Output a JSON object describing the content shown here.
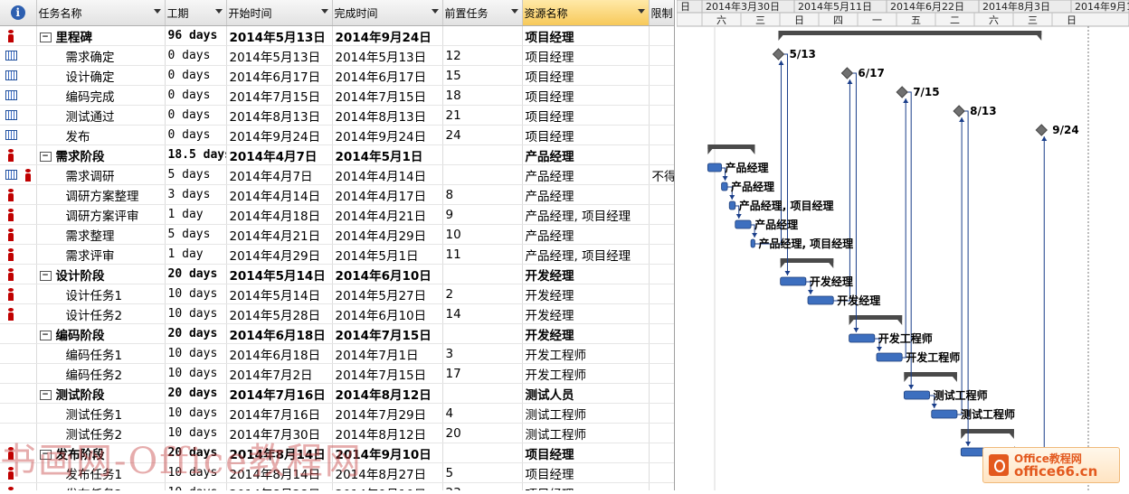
{
  "header": {
    "indicator_col_icon": "info-icon",
    "columns": [
      "任务名称",
      "工期",
      "开始时间",
      "完成时间",
      "前置任务",
      "资源名称",
      "限制"
    ],
    "gantt_weeks": [
      "日",
      "2014年3月30日",
      "2014年5月11日",
      "2014年6月22日",
      "2014年8月3日",
      "2014年9月14"
    ],
    "gantt_days": [
      "六",
      "三",
      "日",
      "四",
      "一",
      "五",
      "二",
      "六",
      "三",
      "日"
    ]
  },
  "rows": [
    {
      "name": "里程碑",
      "dur": "96 days",
      "start": "2014年5月13日",
      "finish": "2014年9月24日",
      "pred": "",
      "res": "项目经理",
      "lim": "",
      "summary": true,
      "ind": "person"
    },
    {
      "name": "需求确定",
      "dur": "0 days",
      "start": "2014年5月13日",
      "finish": "2014年5月13日",
      "pred": "12",
      "res": "项目经理",
      "lim": "",
      "summary": false,
      "ind": "calendar"
    },
    {
      "name": "设计确定",
      "dur": "0 days",
      "start": "2014年6月17日",
      "finish": "2014年6月17日",
      "pred": "15",
      "res": "项目经理",
      "lim": "",
      "summary": false,
      "ind": "calendar"
    },
    {
      "name": "编码完成",
      "dur": "0 days",
      "start": "2014年7月15日",
      "finish": "2014年7月15日",
      "pred": "18",
      "res": "项目经理",
      "lim": "",
      "summary": false,
      "ind": "calendar"
    },
    {
      "name": "测试通过",
      "dur": "0 days",
      "start": "2014年8月13日",
      "finish": "2014年8月13日",
      "pred": "21",
      "res": "项目经理",
      "lim": "",
      "summary": false,
      "ind": "calendar"
    },
    {
      "name": "发布",
      "dur": "0 days",
      "start": "2014年9月24日",
      "finish": "2014年9月24日",
      "pred": "24",
      "res": "项目经理",
      "lim": "",
      "summary": false,
      "ind": "calendar"
    },
    {
      "name": "需求阶段",
      "dur": "18.5 days",
      "start": "2014年4月7日",
      "finish": "2014年5月1日",
      "pred": "",
      "res": "产品经理",
      "lim": "",
      "summary": true,
      "ind": "person"
    },
    {
      "name": "需求调研",
      "dur": "5 days",
      "start": "2014年4月7日",
      "finish": "2014年4月14日",
      "pred": "",
      "res": "产品经理",
      "lim": "不得",
      "summary": false,
      "ind": "calendar-person"
    },
    {
      "name": "调研方案整理",
      "dur": "3 days",
      "start": "2014年4月14日",
      "finish": "2014年4月17日",
      "pred": "8",
      "res": "产品经理",
      "lim": "",
      "summary": false,
      "ind": "person"
    },
    {
      "name": "调研方案评审",
      "dur": "1 day",
      "start": "2014年4月18日",
      "finish": "2014年4月21日",
      "pred": "9",
      "res": "产品经理, 项目经理",
      "lim": "",
      "summary": false,
      "ind": "person"
    },
    {
      "name": "需求整理",
      "dur": "5 days",
      "start": "2014年4月21日",
      "finish": "2014年4月29日",
      "pred": "10",
      "res": "产品经理",
      "lim": "",
      "summary": false,
      "ind": "person"
    },
    {
      "name": "需求评审",
      "dur": "1 day",
      "start": "2014年4月29日",
      "finish": "2014年5月1日",
      "pred": "11",
      "res": "产品经理, 项目经理",
      "lim": "",
      "summary": false,
      "ind": "person"
    },
    {
      "name": "设计阶段",
      "dur": "20 days",
      "start": "2014年5月14日",
      "finish": "2014年6月10日",
      "pred": "",
      "res": "开发经理",
      "lim": "",
      "summary": true,
      "ind": "person"
    },
    {
      "name": "设计任务1",
      "dur": "10 days",
      "start": "2014年5月14日",
      "finish": "2014年5月27日",
      "pred": "2",
      "res": "开发经理",
      "lim": "",
      "summary": false,
      "ind": "person"
    },
    {
      "name": "设计任务2",
      "dur": "10 days",
      "start": "2014年5月28日",
      "finish": "2014年6月10日",
      "pred": "14",
      "res": "开发经理",
      "lim": "",
      "summary": false,
      "ind": "person"
    },
    {
      "name": "编码阶段",
      "dur": "20 days",
      "start": "2014年6月18日",
      "finish": "2014年7月15日",
      "pred": "",
      "res": "开发经理",
      "lim": "",
      "summary": true,
      "ind": ""
    },
    {
      "name": "编码任务1",
      "dur": "10 days",
      "start": "2014年6月18日",
      "finish": "2014年7月1日",
      "pred": "3",
      "res": "开发工程师",
      "lim": "",
      "summary": false,
      "ind": ""
    },
    {
      "name": "编码任务2",
      "dur": "10 days",
      "start": "2014年7月2日",
      "finish": "2014年7月15日",
      "pred": "17",
      "res": "开发工程师",
      "lim": "",
      "summary": false,
      "ind": ""
    },
    {
      "name": "测试阶段",
      "dur": "20 days",
      "start": "2014年7月16日",
      "finish": "2014年8月12日",
      "pred": "",
      "res": "测试人员",
      "lim": "",
      "summary": true,
      "ind": ""
    },
    {
      "name": "测试任务1",
      "dur": "10 days",
      "start": "2014年7月16日",
      "finish": "2014年7月29日",
      "pred": "4",
      "res": "测试工程师",
      "lim": "",
      "summary": false,
      "ind": ""
    },
    {
      "name": "测试任务2",
      "dur": "10 days",
      "start": "2014年7月30日",
      "finish": "2014年8月12日",
      "pred": "20",
      "res": "测试工程师",
      "lim": "",
      "summary": false,
      "ind": ""
    },
    {
      "name": "发布阶段",
      "dur": "20 days",
      "start": "2014年8月14日",
      "finish": "2014年9月10日",
      "pred": "",
      "res": "项目经理",
      "lim": "",
      "summary": true,
      "ind": "person"
    },
    {
      "name": "发布任务1",
      "dur": "10 days",
      "start": "2014年8月14日",
      "finish": "2014年8月27日",
      "pred": "5",
      "res": "项目经理",
      "lim": "",
      "summary": false,
      "ind": "person"
    },
    {
      "name": "发布任务2",
      "dur": "10 days",
      "start": "2014年8月28日",
      "finish": "2014年9月10日",
      "pred": "23",
      "res": "项目经理",
      "lim": "",
      "summary": false,
      "ind": "person"
    }
  ],
  "gantt": {
    "timeline_start": "2014-03-30",
    "milestones": [
      {
        "row": 1,
        "date": "2014-05-13",
        "label": "5/13"
      },
      {
        "row": 2,
        "date": "2014-06-17",
        "label": "6/17"
      },
      {
        "row": 3,
        "date": "2014-07-15",
        "label": "7/15"
      },
      {
        "row": 4,
        "date": "2014-08-13",
        "label": "8/13"
      },
      {
        "row": 5,
        "date": "2014-09-24",
        "label": "9/24"
      }
    ],
    "tasks": [
      {
        "row": 7,
        "start": "2014-04-07",
        "end": "2014-04-14",
        "label": "产品经理"
      },
      {
        "row": 8,
        "start": "2014-04-14",
        "end": "2014-04-17",
        "label": "产品经理"
      },
      {
        "row": 9,
        "start": "2014-04-18",
        "end": "2014-04-21",
        "label": "产品经理, 项目经理"
      },
      {
        "row": 10,
        "start": "2014-04-21",
        "end": "2014-04-29",
        "label": "产品经理"
      },
      {
        "row": 11,
        "start": "2014-04-29",
        "end": "2014-05-01",
        "label": "产品经理, 项目经理"
      },
      {
        "row": 13,
        "start": "2014-05-14",
        "end": "2014-05-27",
        "label": "开发经理"
      },
      {
        "row": 14,
        "start": "2014-05-28",
        "end": "2014-06-10",
        "label": "开发经理"
      },
      {
        "row": 16,
        "start": "2014-06-18",
        "end": "2014-07-01",
        "label": "开发工程师"
      },
      {
        "row": 17,
        "start": "2014-07-02",
        "end": "2014-07-15",
        "label": "开发工程师"
      },
      {
        "row": 19,
        "start": "2014-07-16",
        "end": "2014-07-29",
        "label": "测试工程师"
      },
      {
        "row": 20,
        "start": "2014-07-30",
        "end": "2014-08-12",
        "label": "测试工程师"
      },
      {
        "row": 22,
        "start": "2014-08-14",
        "end": "2014-08-27",
        "label": "项目经理"
      },
      {
        "row": 23,
        "start": "2014-08-28",
        "end": "2014-09-10",
        "label": "项目经"
      }
    ],
    "summaries": [
      {
        "row": 0,
        "start": "2014-05-13",
        "end": "2014-09-24"
      },
      {
        "row": 6,
        "start": "2014-04-07",
        "end": "2014-05-01"
      },
      {
        "row": 12,
        "start": "2014-05-14",
        "end": "2014-06-10"
      },
      {
        "row": 15,
        "start": "2014-06-18",
        "end": "2014-07-15"
      },
      {
        "row": 18,
        "start": "2014-07-16",
        "end": "2014-08-12"
      },
      {
        "row": 21,
        "start": "2014-08-14",
        "end": "2014-09-10"
      }
    ],
    "links": [
      {
        "from_row": 7,
        "to_row": 8
      },
      {
        "from_row": 8,
        "to_row": 9
      },
      {
        "from_row": 9,
        "to_row": 10
      },
      {
        "from_row": 10,
        "to_row": 11
      },
      {
        "from_row": 13,
        "to_row": 14
      },
      {
        "from_row": 16,
        "to_row": 17
      },
      {
        "from_row": 19,
        "to_row": 20
      },
      {
        "from_row": 22,
        "to_row": 23
      },
      {
        "from_row": 11,
        "to_row": 1
      },
      {
        "from_row": 14,
        "to_row": 2
      },
      {
        "from_row": 17,
        "to_row": 3
      },
      {
        "from_row": 20,
        "to_row": 4
      },
      {
        "from_row": 23,
        "to_row": 5
      },
      {
        "from_row": 1,
        "to_row": 13
      },
      {
        "from_row": 2,
        "to_row": 16
      },
      {
        "from_row": 3,
        "to_row": 19
      },
      {
        "from_row": 4,
        "to_row": 22
      }
    ]
  },
  "watermark": "书画网-Office教程网",
  "logo": {
    "line1": "Office教程网",
    "line2": "office66.cn"
  },
  "colors": {
    "bar": "#3d6fbf",
    "summary": "#4a4a4a",
    "milestone": "#707070",
    "person": "#c00000",
    "header_sel": "#f7c95a"
  }
}
